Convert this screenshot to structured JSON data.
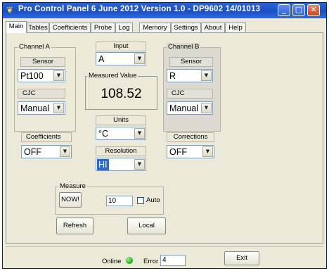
{
  "window": {
    "title": "Pro Control Panel 6 June 2012 Version 1.0 - DP9602 14/01013"
  },
  "tabs": [
    "Main",
    "Tables",
    "Coefficients",
    "Probe",
    "Log",
    "Memory",
    "Settings",
    "About",
    "Help"
  ],
  "channel_a": {
    "label": "Channel A",
    "sensor_label": "Sensor",
    "sensor_value": "Pt100",
    "cjc_label": "CJC",
    "cjc_value": "Manual"
  },
  "channel_b": {
    "label": "Channel B",
    "sensor_label": "Sensor",
    "sensor_value": "R",
    "cjc_label": "CJC",
    "cjc_value": "Manual"
  },
  "input": {
    "label": "Input",
    "value": "A"
  },
  "measured": {
    "label": "Measured Value",
    "value": "108.52"
  },
  "units": {
    "label": "Units",
    "value": "°C"
  },
  "resolution": {
    "label": "Resolution",
    "value": "HI"
  },
  "coefficients": {
    "label": "Coefficients",
    "value": "OFF"
  },
  "corrections": {
    "label": "Corrections",
    "value": "OFF"
  },
  "measure": {
    "label": "Measure",
    "now_label": "NOW!",
    "count_value": "10",
    "auto_label": "Auto"
  },
  "buttons": {
    "refresh": "Refresh",
    "local": "Local",
    "exit": "Exit"
  },
  "status": {
    "online_label": "Online",
    "error_label": "Error",
    "error_value": "4",
    "online_color": "#29b51b"
  }
}
